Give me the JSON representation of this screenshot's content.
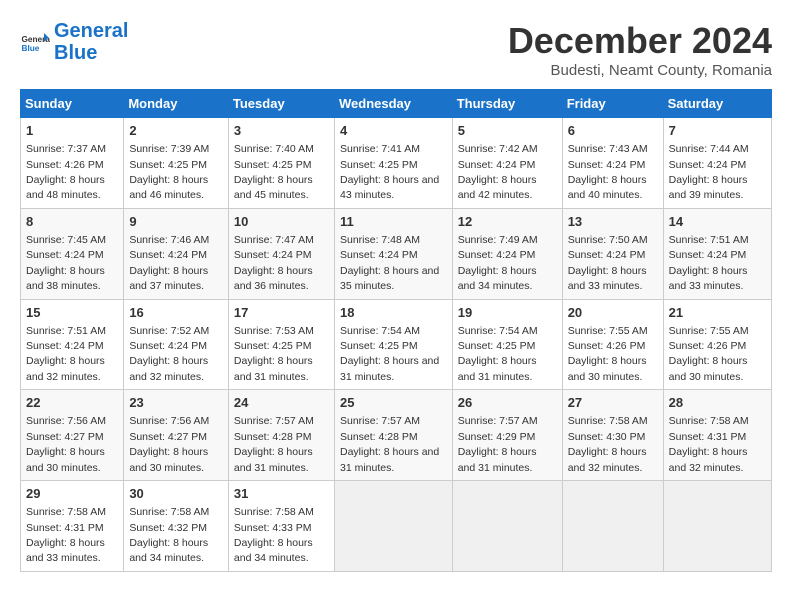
{
  "header": {
    "logo_line1": "General",
    "logo_line2": "Blue",
    "title": "December 2024",
    "location": "Budesti, Neamt County, Romania"
  },
  "calendar": {
    "days_of_week": [
      "Sunday",
      "Monday",
      "Tuesday",
      "Wednesday",
      "Thursday",
      "Friday",
      "Saturday"
    ],
    "weeks": [
      [
        null,
        null,
        null,
        null,
        null,
        null,
        null
      ]
    ],
    "cells": [
      [
        {
          "day": "1",
          "rise": "7:37 AM",
          "set": "4:26 PM",
          "daylight": "8 hours and 48 minutes."
        },
        {
          "day": "2",
          "rise": "7:39 AM",
          "set": "4:25 PM",
          "daylight": "8 hours and 46 minutes."
        },
        {
          "day": "3",
          "rise": "7:40 AM",
          "set": "4:25 PM",
          "daylight": "8 hours and 45 minutes."
        },
        {
          "day": "4",
          "rise": "7:41 AM",
          "set": "4:25 PM",
          "daylight": "8 hours and 43 minutes."
        },
        {
          "day": "5",
          "rise": "7:42 AM",
          "set": "4:24 PM",
          "daylight": "8 hours and 42 minutes."
        },
        {
          "day": "6",
          "rise": "7:43 AM",
          "set": "4:24 PM",
          "daylight": "8 hours and 40 minutes."
        },
        {
          "day": "7",
          "rise": "7:44 AM",
          "set": "4:24 PM",
          "daylight": "8 hours and 39 minutes."
        }
      ],
      [
        {
          "day": "8",
          "rise": "7:45 AM",
          "set": "4:24 PM",
          "daylight": "8 hours and 38 minutes."
        },
        {
          "day": "9",
          "rise": "7:46 AM",
          "set": "4:24 PM",
          "daylight": "8 hours and 37 minutes."
        },
        {
          "day": "10",
          "rise": "7:47 AM",
          "set": "4:24 PM",
          "daylight": "8 hours and 36 minutes."
        },
        {
          "day": "11",
          "rise": "7:48 AM",
          "set": "4:24 PM",
          "daylight": "8 hours and 35 minutes."
        },
        {
          "day": "12",
          "rise": "7:49 AM",
          "set": "4:24 PM",
          "daylight": "8 hours and 34 minutes."
        },
        {
          "day": "13",
          "rise": "7:50 AM",
          "set": "4:24 PM",
          "daylight": "8 hours and 33 minutes."
        },
        {
          "day": "14",
          "rise": "7:51 AM",
          "set": "4:24 PM",
          "daylight": "8 hours and 33 minutes."
        }
      ],
      [
        {
          "day": "15",
          "rise": "7:51 AM",
          "set": "4:24 PM",
          "daylight": "8 hours and 32 minutes."
        },
        {
          "day": "16",
          "rise": "7:52 AM",
          "set": "4:24 PM",
          "daylight": "8 hours and 32 minutes."
        },
        {
          "day": "17",
          "rise": "7:53 AM",
          "set": "4:25 PM",
          "daylight": "8 hours and 31 minutes."
        },
        {
          "day": "18",
          "rise": "7:54 AM",
          "set": "4:25 PM",
          "daylight": "8 hours and 31 minutes."
        },
        {
          "day": "19",
          "rise": "7:54 AM",
          "set": "4:25 PM",
          "daylight": "8 hours and 31 minutes."
        },
        {
          "day": "20",
          "rise": "7:55 AM",
          "set": "4:26 PM",
          "daylight": "8 hours and 30 minutes."
        },
        {
          "day": "21",
          "rise": "7:55 AM",
          "set": "4:26 PM",
          "daylight": "8 hours and 30 minutes."
        }
      ],
      [
        {
          "day": "22",
          "rise": "7:56 AM",
          "set": "4:27 PM",
          "daylight": "8 hours and 30 minutes."
        },
        {
          "day": "23",
          "rise": "7:56 AM",
          "set": "4:27 PM",
          "daylight": "8 hours and 30 minutes."
        },
        {
          "day": "24",
          "rise": "7:57 AM",
          "set": "4:28 PM",
          "daylight": "8 hours and 31 minutes."
        },
        {
          "day": "25",
          "rise": "7:57 AM",
          "set": "4:28 PM",
          "daylight": "8 hours and 31 minutes."
        },
        {
          "day": "26",
          "rise": "7:57 AM",
          "set": "4:29 PM",
          "daylight": "8 hours and 31 minutes."
        },
        {
          "day": "27",
          "rise": "7:58 AM",
          "set": "4:30 PM",
          "daylight": "8 hours and 32 minutes."
        },
        {
          "day": "28",
          "rise": "7:58 AM",
          "set": "4:31 PM",
          "daylight": "8 hours and 32 minutes."
        }
      ],
      [
        {
          "day": "29",
          "rise": "7:58 AM",
          "set": "4:31 PM",
          "daylight": "8 hours and 33 minutes."
        },
        {
          "day": "30",
          "rise": "7:58 AM",
          "set": "4:32 PM",
          "daylight": "8 hours and 34 minutes."
        },
        {
          "day": "31",
          "rise": "7:58 AM",
          "set": "4:33 PM",
          "daylight": "8 hours and 34 minutes."
        },
        null,
        null,
        null,
        null
      ]
    ]
  }
}
